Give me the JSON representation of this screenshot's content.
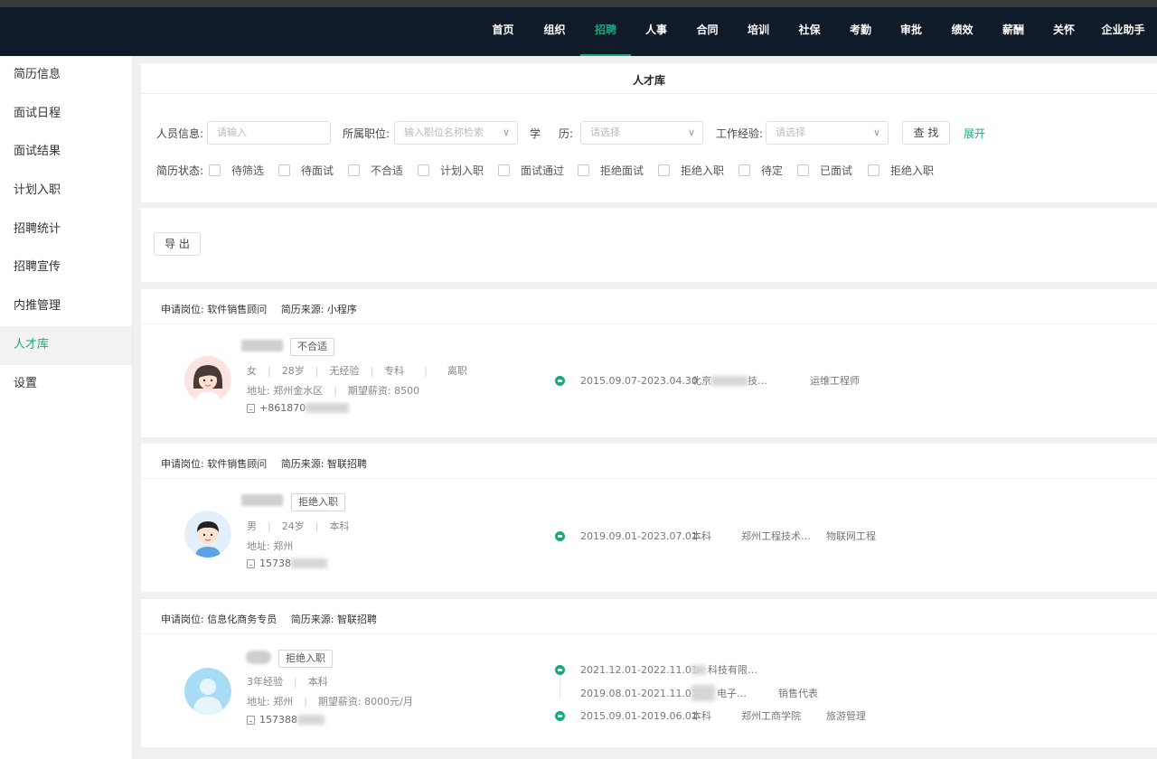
{
  "topnav": {
    "items": [
      {
        "label": "首页",
        "active": false
      },
      {
        "label": "组织",
        "active": false
      },
      {
        "label": "招聘",
        "active": true
      },
      {
        "label": "人事",
        "active": false
      },
      {
        "label": "合同",
        "active": false
      },
      {
        "label": "培训",
        "active": false
      },
      {
        "label": "社保",
        "active": false
      },
      {
        "label": "考勤",
        "active": false
      },
      {
        "label": "审批",
        "active": false
      },
      {
        "label": "绩效",
        "active": false
      },
      {
        "label": "薪酬",
        "active": false
      },
      {
        "label": "关怀",
        "active": false
      },
      {
        "label": "企业助手",
        "active": false
      }
    ]
  },
  "sidebar": {
    "items": [
      {
        "label": "简历信息",
        "active": false
      },
      {
        "label": "面试日程",
        "active": false
      },
      {
        "label": "面试结果",
        "active": false
      },
      {
        "label": "计划入职",
        "active": false
      },
      {
        "label": "招聘统计",
        "active": false
      },
      {
        "label": "招聘宣传",
        "active": false
      },
      {
        "label": "内推管理",
        "active": false
      },
      {
        "label": "人才库",
        "active": true
      },
      {
        "label": "设置",
        "active": false
      }
    ]
  },
  "page": {
    "title": "人才库"
  },
  "filters": {
    "person_label": "人员信息:",
    "person_placeholder": "请输入",
    "position_label": "所属职位:",
    "position_placeholder": "输入职位名称检索",
    "education_label_a": "学",
    "education_label_b": "历:",
    "education_placeholder": "请选择",
    "experience_label": "工作经验:",
    "experience_placeholder": "请选择",
    "search_button": "查 找",
    "expand_link": "展开",
    "status_label": "简历状态:",
    "statuses": [
      "待筛选",
      "待面试",
      "不合适",
      "计划入职",
      "面试通过",
      "拒绝面试",
      "拒绝入职",
      "待定",
      "已面试",
      "拒绝入职"
    ]
  },
  "toolbar": {
    "export_button": "导 出"
  },
  "cards": [
    {
      "position_label": "申请岗位: 软件销售顾问",
      "source_label": "简历来源: 小程序",
      "status_tag": "不合适",
      "gender": "女",
      "age": "28岁",
      "experience": "无经验",
      "education": "专科",
      "job_status": "离职",
      "address": "地址: 郑州金水区",
      "salary": "期望薪资: 8500",
      "phone": "+861870",
      "exp1": {
        "period": "2015.09.07-2023.04.30",
        "org_a": "北京",
        "org_b": "技…",
        "role": "运维工程师"
      }
    },
    {
      "position_label": "申请岗位: 软件销售顾问",
      "source_label": "简历来源: 智联招聘",
      "status_tag": "拒绝入职",
      "gender": "男",
      "age": "24岁",
      "education": "本科",
      "address": "地址: 郑州",
      "phone": "15738",
      "exp1": {
        "period": "2019.09.01-2023.07.01",
        "degree": "本科",
        "school": "郑州工程技术…",
        "major": "物联网工程"
      }
    },
    {
      "position_label": "申请岗位: 信息化商务专员",
      "source_label": "简历来源: 智联招聘",
      "status_tag": "拒绝入职",
      "experience": "3年经验",
      "education": "本科",
      "address": "地址: 郑州",
      "salary": "期望薪资: 8000元/月",
      "phone": "157388",
      "exp1": {
        "period": "2021.12.01-2022.11.01",
        "org": "科技有限…"
      },
      "exp2": {
        "period": "2019.08.01-2021.11.01",
        "org": "电子…",
        "role": "销售代表"
      },
      "exp3": {
        "period": "2015.09.01-2019.06.01",
        "degree": "本科",
        "school": "郑州工商学院",
        "major": "旅游管理"
      }
    }
  ],
  "colors": {
    "accent": "#19a97b",
    "nav_bg": "#0f1b28",
    "page_bg": "#f0f0f0"
  }
}
